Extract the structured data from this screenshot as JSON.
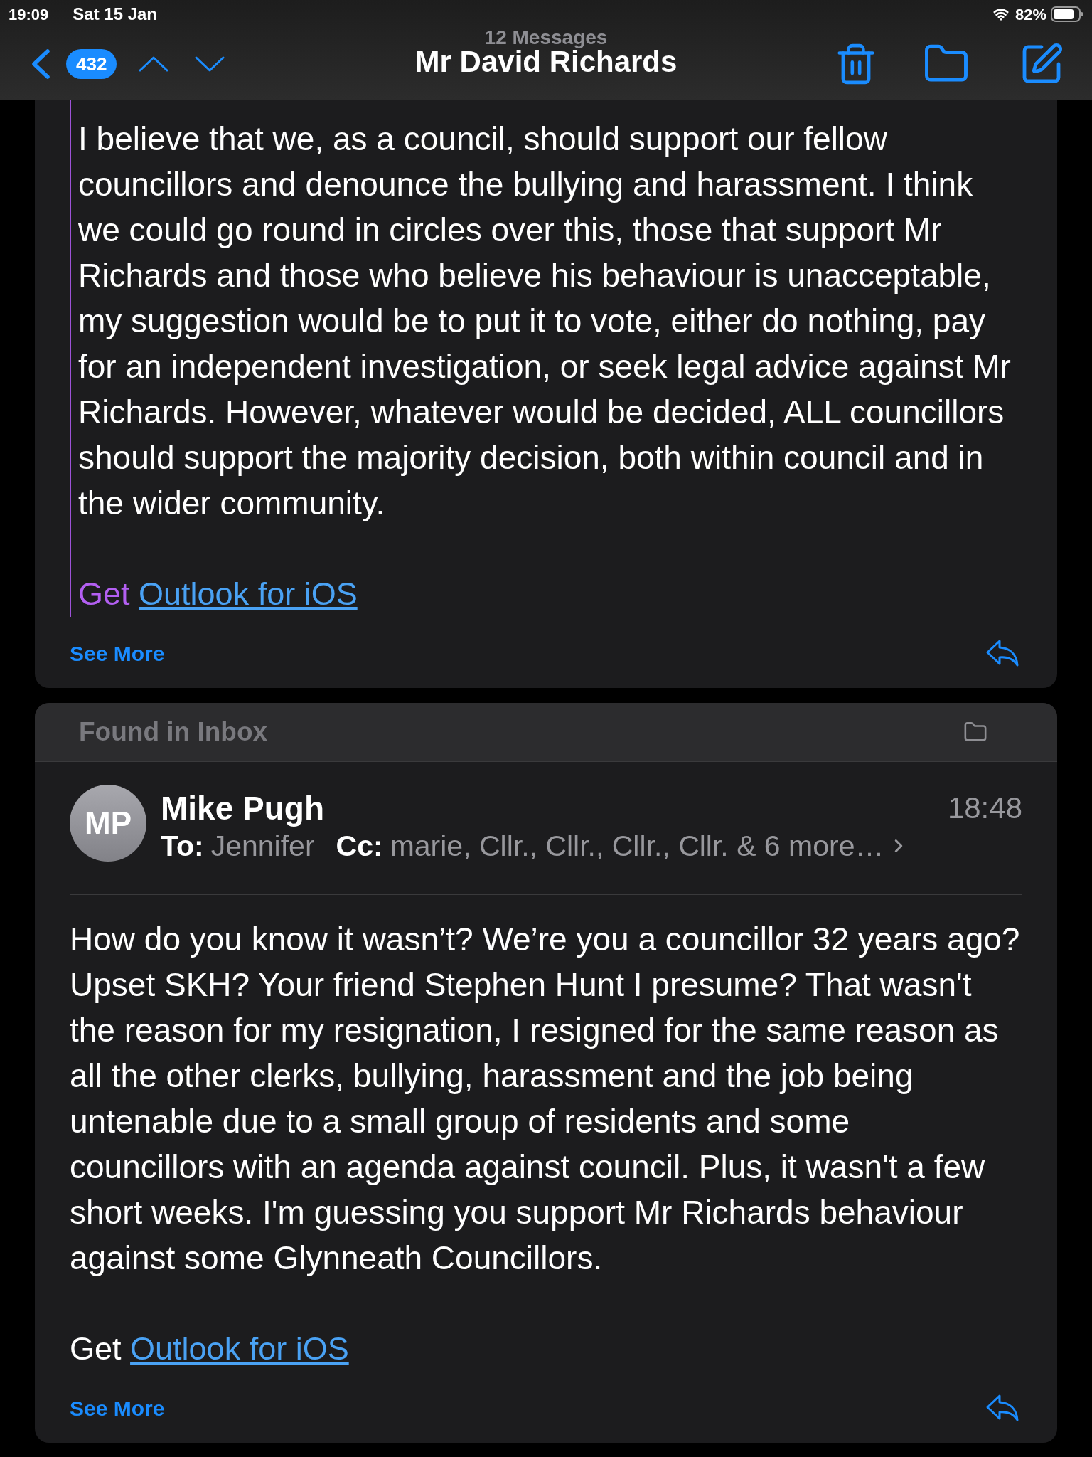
{
  "status_bar": {
    "time": "19:09",
    "date": "Sat 15 Jan",
    "battery": "82%"
  },
  "nav_bar": {
    "unread_count": "432",
    "subtitle": "12 Messages",
    "title": "Mr David Richards"
  },
  "messages": [
    {
      "quoted": true,
      "body": "I believe that we, as a council, should support our fellow\ncouncillors and denounce the bullying and harassment. I think\nwe could go round in circles over this, those that support Mr\nRichards and those who believe his behaviour is unacceptable,\nmy suggestion would be to put it to vote, either do nothing, pay\nfor an independent investigation, or seek legal advice against Mr\nRichards. However, whatever would be decided, ALL councillors\nshould support the majority decision, both within council and in\nthe wider community.",
      "signature_prefix": "Get",
      "signature_link": "Outlook for iOS",
      "see_more": "See More"
    },
    {
      "quoted": false,
      "folder_label": "Found in Inbox",
      "sender": {
        "initials": "MP",
        "name": "Mike Pugh"
      },
      "time": "18:48",
      "to_label": "To:",
      "to": "Jennifer",
      "cc_label": "Cc:",
      "cc": "marie, Cllr., Cllr., Cllr., Cllr. & 6 more…",
      "body": "How do you know it wasn’t? We’re you a councillor 32 years ago?\nUpset SKH? Your friend Stephen Hunt I presume? That wasn't\nthe reason for my resignation, I resigned for the same reason as\nall the other clerks, bullying, harassment and the job being\nuntenable due to a small group of residents and some\ncouncillors with an agenda against council. Plus, it wasn't a few\nshort weeks. I'm guessing you support Mr Richards behaviour\nagainst some Glynneath Councillors.",
      "signature_prefix": "Get",
      "signature_link": "Outlook for iOS",
      "see_more": "See More"
    }
  ]
}
